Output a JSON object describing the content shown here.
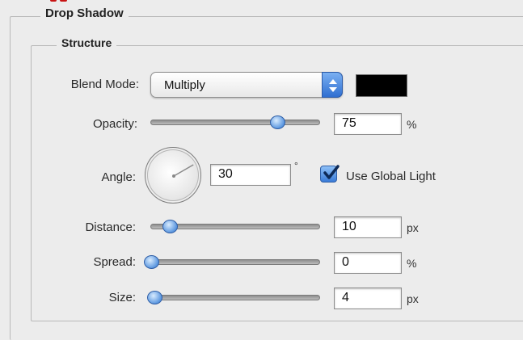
{
  "panel": {
    "title": "Drop Shadow",
    "section": "Structure"
  },
  "blend_mode": {
    "label": "Blend Mode:",
    "value": "Multiply",
    "color_swatch": "#000000"
  },
  "opacity": {
    "label": "Opacity:",
    "value": "75",
    "unit": "%",
    "slider_fraction": 0.75
  },
  "angle": {
    "label": "Angle:",
    "value": "30",
    "unit": "°",
    "degrees": 30
  },
  "global_light": {
    "label": "Use Global Light",
    "checked": true
  },
  "distance": {
    "label": "Distance:",
    "value": "10",
    "unit": "px",
    "slider_fraction": 0.11
  },
  "spread": {
    "label": "Spread:",
    "value": "0",
    "unit": "%",
    "slider_fraction": 0.0
  },
  "size": {
    "label": "Size:",
    "value": "4",
    "unit": "px",
    "slider_fraction": 0.02
  },
  "colors": {
    "accent": "#3a7bd8",
    "background": "#ececec"
  }
}
